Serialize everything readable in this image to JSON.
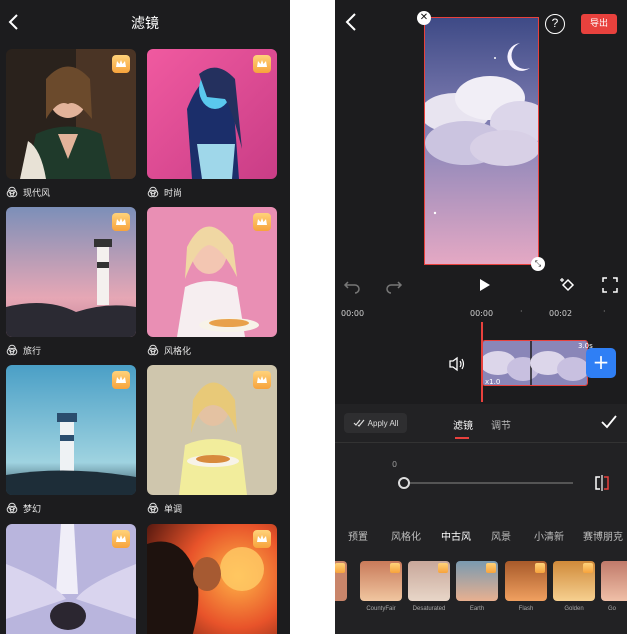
{
  "left": {
    "title": "滤镜",
    "cards": [
      {
        "label": "现代风",
        "premium": true
      },
      {
        "label": "时尚",
        "premium": true
      },
      {
        "label": "旅行",
        "premium": true
      },
      {
        "label": "风格化",
        "premium": true
      },
      {
        "label": "梦幻",
        "premium": true
      },
      {
        "label": "单调",
        "premium": true
      },
      {
        "label": "",
        "premium": true
      },
      {
        "label": "",
        "premium": true
      }
    ]
  },
  "right": {
    "export_label": "导出",
    "help_label": "?",
    "time_current": "00:00",
    "ruler": [
      "00:00",
      "00:02"
    ],
    "clip_duration": "3.0s",
    "clip_speed": "x1.0",
    "apply_all": "Apply All",
    "tabs": [
      "滤镜",
      "调节"
    ],
    "slider_value_label": "0",
    "slider_value": 0,
    "categories": [
      "预置",
      "风格化",
      "中古风",
      "风景",
      "小清新",
      "赛博朋克"
    ],
    "active_category": "中古风",
    "filters": [
      "",
      "CountyFair",
      "Desaturated",
      "Earth",
      "Flash",
      "Golden",
      "Go"
    ]
  },
  "colors": {
    "accent": "#e8413d",
    "blue": "#2f7ff5",
    "bg": "#1c1c1e"
  }
}
